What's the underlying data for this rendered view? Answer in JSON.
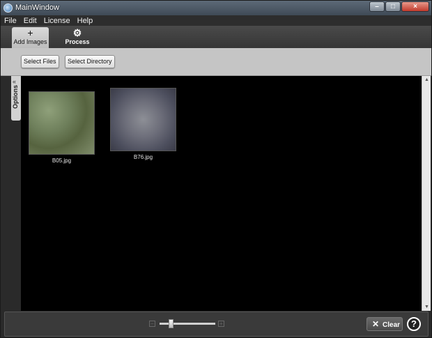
{
  "window": {
    "title": "MainWindow",
    "app_icon": "app-logo-icon"
  },
  "menu": [
    "File",
    "Edit",
    "License",
    "Help"
  ],
  "tabs": [
    {
      "label": "Add Images",
      "icon": "plus-icon",
      "glyph": "+"
    },
    {
      "label": "Process",
      "icon": "gear-icon",
      "glyph": "⚙"
    }
  ],
  "toolbar": {
    "select_files": "Select Files",
    "select_directory": "Select Directory"
  },
  "options_panel": {
    "label": "Options",
    "chevron": "«"
  },
  "images": [
    {
      "filename": "B05.jpg"
    },
    {
      "filename": "B76.jpg"
    }
  ],
  "bottom": {
    "clear_label": "Clear",
    "clear_icon": "close-x-icon",
    "help_label": "?",
    "zoom_level": 0.18
  }
}
